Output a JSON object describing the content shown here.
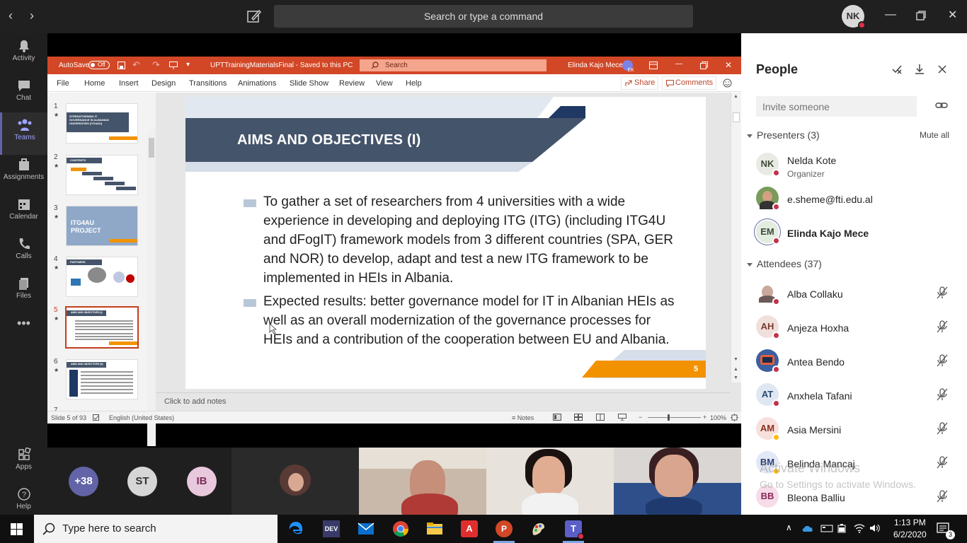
{
  "teams": {
    "command_placeholder": "Search or type a command",
    "user_initials": "NK",
    "rail": [
      {
        "label": "Activity",
        "icon": "bell-icon"
      },
      {
        "label": "Chat",
        "icon": "chat-icon"
      },
      {
        "label": "Teams",
        "icon": "teams-icon"
      },
      {
        "label": "Assignments",
        "icon": "assignments-icon"
      },
      {
        "label": "Calendar",
        "icon": "calendar-icon"
      },
      {
        "label": "Calls",
        "icon": "phone-icon"
      },
      {
        "label": "Files",
        "icon": "files-icon"
      }
    ],
    "rail_bottom": [
      {
        "label": "Apps",
        "icon": "apps-icon"
      },
      {
        "label": "Help",
        "icon": "help-icon"
      }
    ]
  },
  "ppt": {
    "autosave_label": "AutoSave",
    "autosave_state": "Off",
    "doc_title": "UPTTrainingMaterialsFinal  -  Saved to this PC",
    "search_placeholder": "Search",
    "user_name": "Elinda Kajo Mece",
    "user_initials": "EK",
    "ribbon_tabs": [
      "File",
      "Home",
      "Insert",
      "Design",
      "Transitions",
      "Animations",
      "Slide Show",
      "Review",
      "View",
      "Help"
    ],
    "share_label": "Share",
    "comments_label": "Comments",
    "thumbnails": [
      {
        "num": "1",
        "text": "STRENGTHENING IT GOVERNANCE IN ALBANIAN UNIVERSITIES (ITG4AU)"
      },
      {
        "num": "2",
        "text": "CONTENTS"
      },
      {
        "num": "3",
        "text": "ITG4AU PROJECT"
      },
      {
        "num": "4",
        "text": "PARTNERS"
      },
      {
        "num": "5",
        "text": "AIMS AND OBJECTIVES (I)"
      },
      {
        "num": "6",
        "text": "AIMS AND OBJECTIVES (II)"
      },
      {
        "num": "7",
        "text": ""
      }
    ],
    "selected_slide": 5,
    "slide": {
      "title": "AIMS AND OBJECTIVES (I)",
      "bullets": [
        "To gather a set of researchers from 4 universities with a wide experience in developing and deploying ITG (ITG) (including ITG4U and dFogIT) framework models from 3 different countries (SPA, GER and NOR) to develop, adapt and test a new ITG framework to be implemented in HEIs in Albania.",
        "Expected results: better governance model for IT in Albanian HEIs as well as an overall modernization of the governance processes for HEIs and a contribution of the cooperation between EU and Albania."
      ],
      "number": "5"
    },
    "notes_placeholder": "Click to add notes",
    "status": {
      "slide_of": "Slide 5 of 93",
      "language": "English (United States)",
      "notes_label": "Notes",
      "zoom": "100%"
    }
  },
  "video": {
    "overflow_count": "+38",
    "avatars": [
      {
        "initials": "ST",
        "color": "#d6d6d6"
      },
      {
        "initials": "IB",
        "color": "#e8c8dc"
      }
    ]
  },
  "people": {
    "title": "People",
    "invite_placeholder": "Invite someone",
    "presenters_label": "Presenters (3)",
    "mute_all_label": "Mute all",
    "presenters": [
      {
        "name": "Nelda Kote",
        "role": "Organizer",
        "initials": "NK",
        "color": "#e8ebe4",
        "text_color": "#3d4a3a"
      },
      {
        "name": "e.sheme@fti.edu.al",
        "role": "",
        "initials": "",
        "color": "#7a9b59",
        "text_color": "#fff"
      },
      {
        "name": "Elinda Kajo Mece",
        "role": "",
        "initials": "EM",
        "color": "#e3ecdf",
        "text_color": "#3d4a3a"
      }
    ],
    "attendees_label": "Attendees (37)",
    "attendees": [
      {
        "name": "Alba Collaku",
        "initials": "",
        "color": "#d9c8c3",
        "text_color": "#fff"
      },
      {
        "name": "Anjeza Hoxha",
        "initials": "AH",
        "color": "#f0e0dc",
        "text_color": "#7a3b2e"
      },
      {
        "name": "Antea Bendo",
        "initials": "",
        "color": "#3b5fa0",
        "text_color": "#fff"
      },
      {
        "name": "Anxhela Tafani",
        "initials": "AT",
        "color": "#dfe8f2",
        "text_color": "#2b4a6d"
      },
      {
        "name": "Asia Mersini",
        "initials": "AM",
        "color": "#f7e0dc",
        "text_color": "#8a2f1e"
      },
      {
        "name": "Belinda Mancaj",
        "initials": "BM",
        "color": "#e2e8f5",
        "text_color": "#2b3f70"
      },
      {
        "name": "Bleona Balliu",
        "initials": "BB",
        "color": "#f5dce8",
        "text_color": "#8a2656"
      }
    ]
  },
  "watermark": {
    "line1": "Activate Windows",
    "line2": "Go to Settings to activate Windows."
  },
  "taskbar": {
    "search_placeholder": "Type here to search",
    "time": "1:13 PM",
    "date": "6/2/2020",
    "notification_count": "3"
  }
}
